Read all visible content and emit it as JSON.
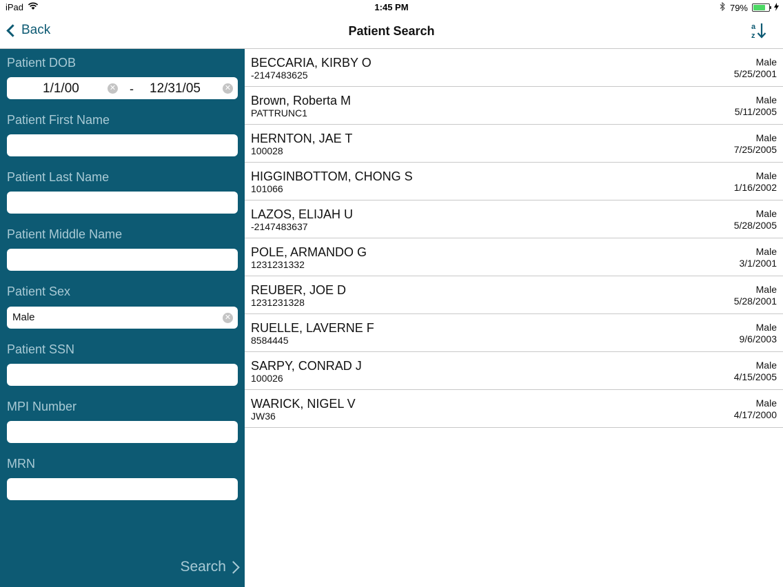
{
  "status_bar": {
    "device": "iPad",
    "time": "1:45 PM",
    "battery": "79%",
    "battery_level": 0.79,
    "icons": [
      "wifi-icon",
      "bluetooth-icon",
      "battery-icon",
      "charging-icon"
    ]
  },
  "nav": {
    "back_label": "Back",
    "title": "Patient Search",
    "sort_icon": "sort-az-icon"
  },
  "colors": {
    "sidebar": "#0d5a73",
    "label": "#a9cad5",
    "accent": "#0d5a73"
  },
  "form": {
    "dob_label": "Patient DOB",
    "dob_from": "1/1/00",
    "dob_separator": "-",
    "dob_to": "12/31/05",
    "first_name_label": "Patient First Name",
    "first_name_value": "",
    "last_name_label": "Patient Last Name",
    "last_name_value": "",
    "middle_name_label": "Patient Middle Name",
    "middle_name_value": "",
    "sex_label": "Patient Sex",
    "sex_value": "Male",
    "ssn_label": "Patient SSN",
    "ssn_value": "",
    "mpi_label": "MPI Number",
    "mpi_value": "",
    "mrn_label": "MRN",
    "mrn_value": "",
    "search_label": "Search"
  },
  "results": [
    {
      "name": "BECCARIA, KIRBY O",
      "id": "-2147483625",
      "sex": "Male",
      "dob": "5/25/2001"
    },
    {
      "name": "Brown, Roberta M",
      "id": "PATTRUNC1",
      "sex": "Male",
      "dob": "5/11/2005"
    },
    {
      "name": "HERNTON, JAE T",
      "id": "100028",
      "sex": "Male",
      "dob": "7/25/2005"
    },
    {
      "name": "HIGGINBOTTOM, CHONG S",
      "id": "101066",
      "sex": "Male",
      "dob": "1/16/2002"
    },
    {
      "name": "LAZOS, ELIJAH U",
      "id": "-2147483637",
      "sex": "Male",
      "dob": "5/28/2005"
    },
    {
      "name": "POLE, ARMANDO G",
      "id": "1231231332",
      "sex": "Male",
      "dob": "3/1/2001"
    },
    {
      "name": "REUBER, JOE D",
      "id": "1231231328",
      "sex": "Male",
      "dob": "5/28/2001"
    },
    {
      "name": "RUELLE, LAVERNE F",
      "id": "8584445",
      "sex": "Male",
      "dob": "9/6/2003"
    },
    {
      "name": "SARPY, CONRAD J",
      "id": "100026",
      "sex": "Male",
      "dob": "4/15/2005"
    },
    {
      "name": "WARICK, NIGEL V",
      "id": "JW36",
      "sex": "Male",
      "dob": "4/17/2000"
    }
  ]
}
